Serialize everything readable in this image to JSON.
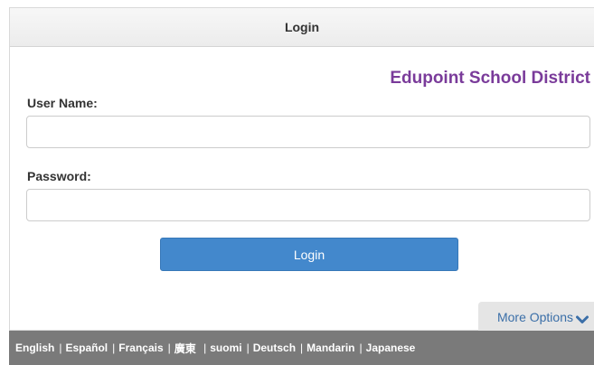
{
  "header": {
    "title": "Login"
  },
  "district_name": "Edupoint School District",
  "form": {
    "username_label": "User Name:",
    "username_value": "",
    "password_label": "Password:",
    "password_value": "",
    "login_button": "Login"
  },
  "more_options": {
    "label": "More Options",
    "icon": "chevron-down-icon"
  },
  "languages": [
    "English",
    "Español",
    "Français",
    "廣東",
    "suomi",
    "Deutsch",
    "Mandarin",
    "Japanese"
  ],
  "colors": {
    "accent": "#4388cc",
    "district": "#7a3b9a",
    "lang_bar": "#7a7a7a",
    "link": "#3b6fa8"
  }
}
